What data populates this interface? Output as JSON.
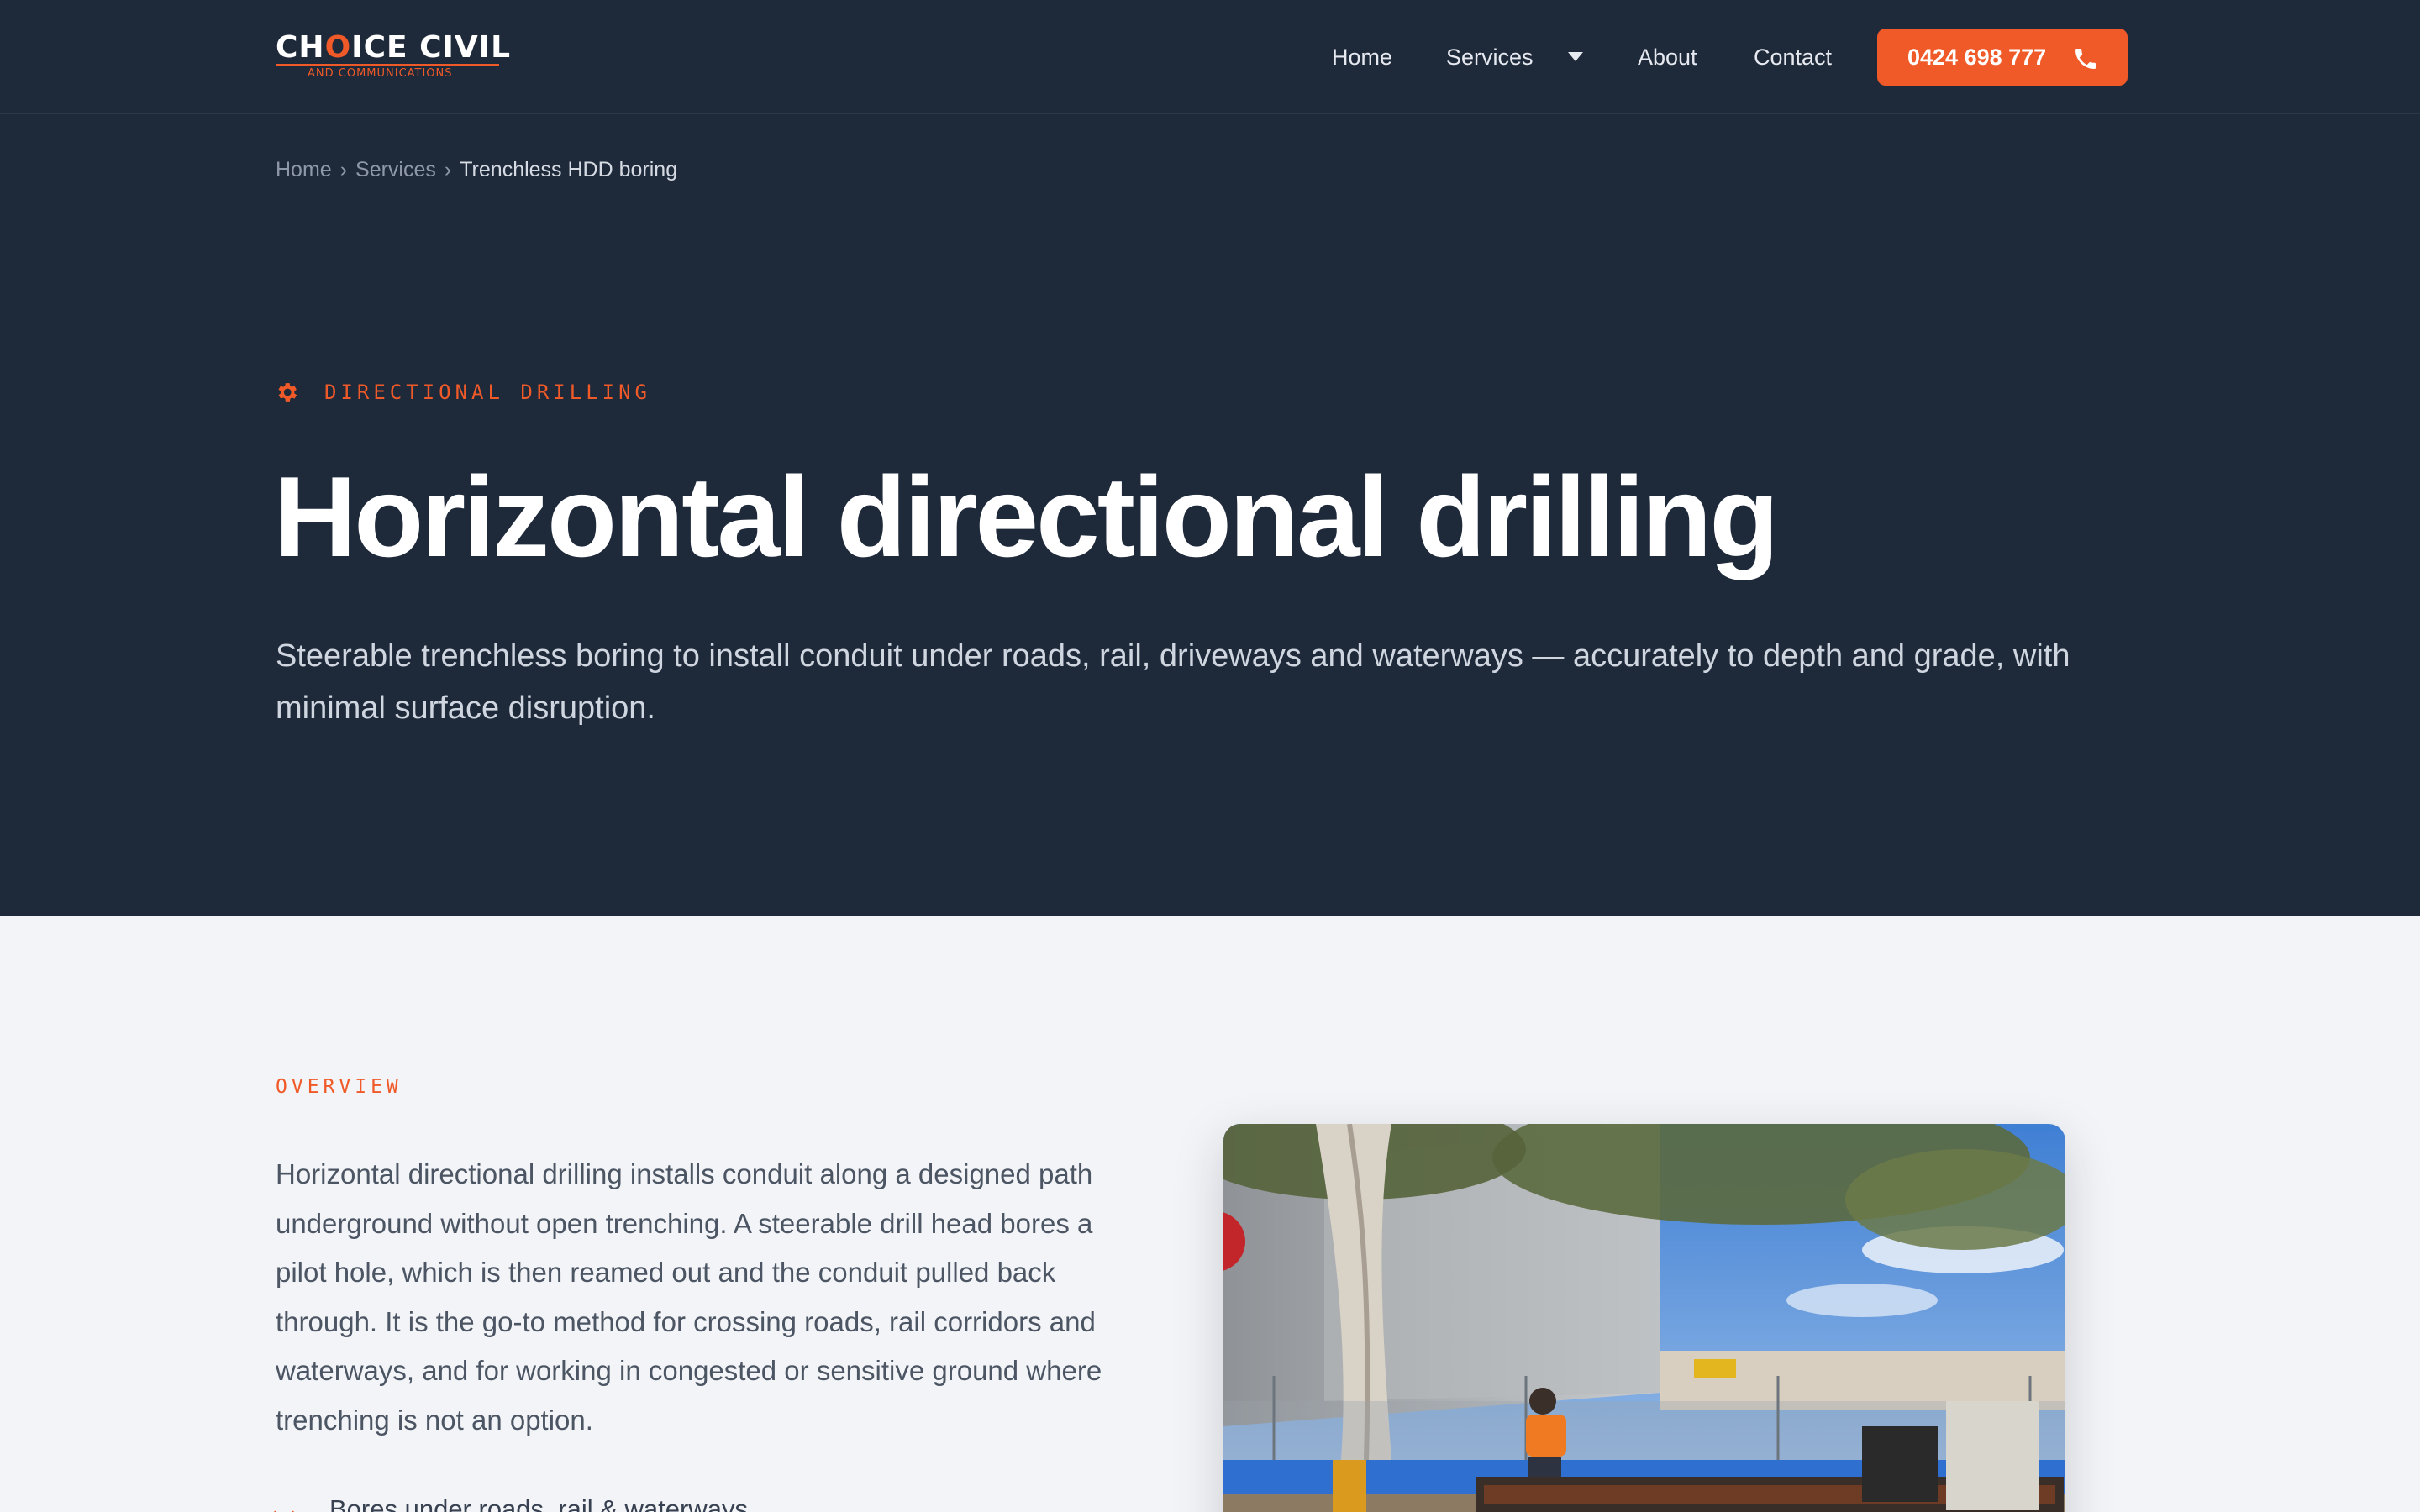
{
  "header": {
    "logo": {
      "main": "CHOICE CIVIL",
      "sub": "AND COMMUNICATIONS"
    },
    "nav": [
      {
        "label": "Home"
      },
      {
        "label": "Services"
      },
      {
        "label": "About"
      },
      {
        "label": "Contact"
      }
    ],
    "phone_button": {
      "label": "0424 698 777",
      "icon": "phone-icon"
    }
  },
  "breadcrumb": [
    {
      "label": "Home"
    },
    {
      "label": "Services"
    },
    {
      "label": "Trenchless HDD boring"
    }
  ],
  "hero": {
    "eyebrow_icon": "gear-icon",
    "eyebrow": "DIRECTIONAL DRILLING",
    "title": "Horizontal directional drilling",
    "description": "Steerable trenchless boring to install conduit under roads, rail, driveways and waterways — accurately to depth and grade, with minimal surface disruption."
  },
  "overview": {
    "label": "OVERVIEW",
    "text": "Horizontal directional drilling installs conduit along a designed path underground without open trenching. A steerable drill head bores a pilot hole, which is then reamed out and the conduit pulled back through. It is the go-to method for crossing roads, rail corridors and waterways, and for working in congested or sensitive ground where trenching is not an option.",
    "bullets": [
      {
        "label": "Bores under roads, rail & waterways"
      }
    ],
    "photo_subject": "worker-operating-drill-rig-photo"
  },
  "colors": {
    "accent": "#f05a28",
    "navy": "#1e293a",
    "light_bg": "#f3f4f7"
  }
}
